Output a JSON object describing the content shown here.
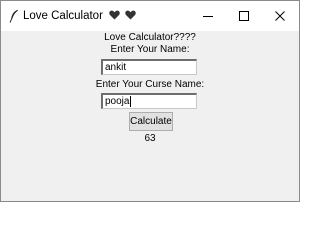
{
  "window": {
    "title": "Love Calculator",
    "title_icons": [
      "feather-icon",
      "black-heart-icon",
      "black-heart-icon"
    ],
    "controls": [
      "minimize-icon",
      "maximize-icon",
      "close-icon"
    ]
  },
  "main": {
    "heading": "Love Calculator????",
    "name_label": "Enter Your Name:",
    "name_value": "ankit",
    "crush_label": "Enter Your Curse Name:",
    "crush_value": "pooja",
    "calculate_label": "Calculate",
    "result": "63"
  }
}
